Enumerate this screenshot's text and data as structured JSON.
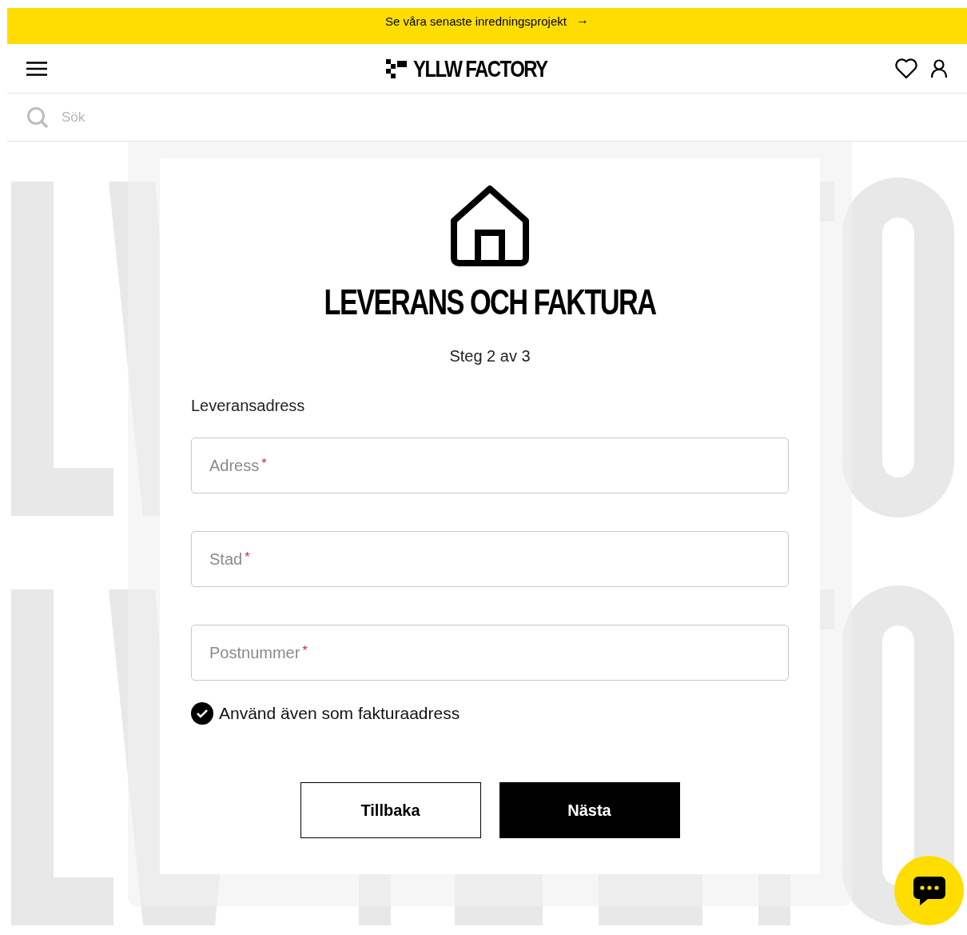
{
  "promo_bar": {
    "text": "Se våra senaste inredningsprojekt",
    "arrow": "→"
  },
  "header": {
    "logo_text": "YLLW FACTORY"
  },
  "search": {
    "placeholder": "Sök"
  },
  "dialog": {
    "title": "LEVERANS OCH FAKTURA",
    "step": "Steg 2 av 3",
    "section_label": "Leveransadress",
    "fields": [
      {
        "placeholder": "Adress",
        "required_mark": "*"
      },
      {
        "placeholder": "Stad",
        "required_mark": "*"
      },
      {
        "placeholder": "Postnummer",
        "required_mark": "*"
      }
    ],
    "checkbox": {
      "label": "Använd även som fakturaadress",
      "checked": true
    },
    "buttons": [
      {
        "label": "Tillbaka",
        "kind": "secondary"
      },
      {
        "label": "Nästa",
        "kind": "primary"
      }
    ]
  }
}
